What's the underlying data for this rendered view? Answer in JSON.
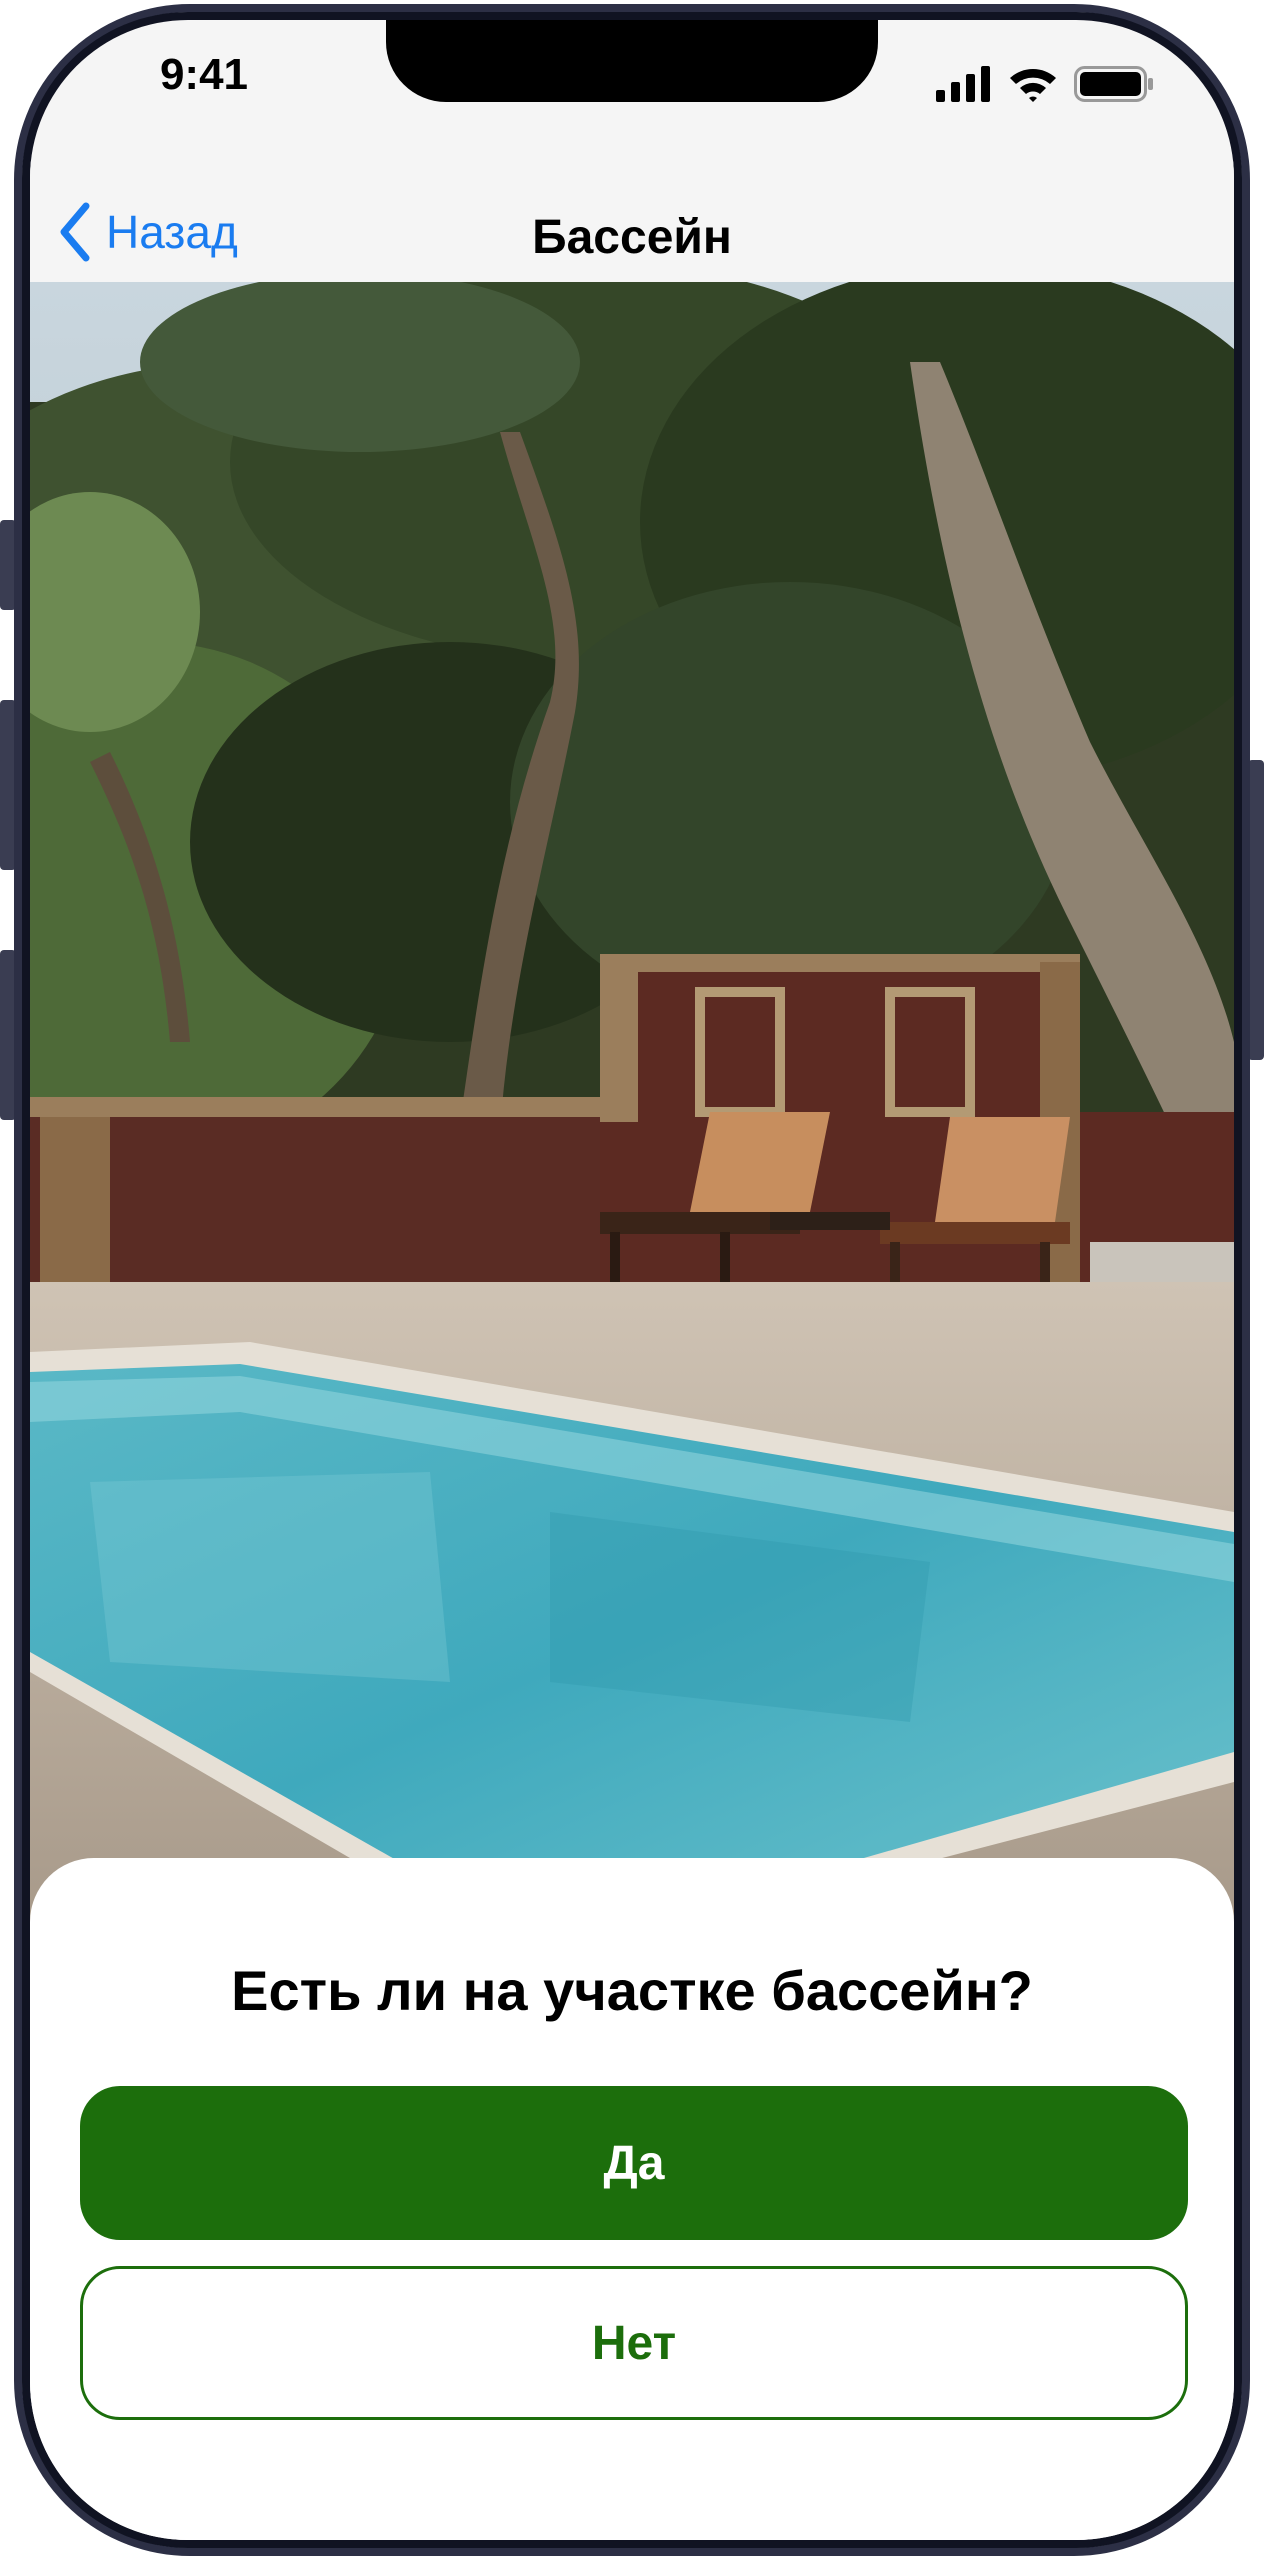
{
  "status_bar": {
    "time": "9:41",
    "icons": [
      "cellular-signal-icon",
      "wifi-icon",
      "battery-icon"
    ]
  },
  "nav": {
    "back_label": "Назад",
    "title": "Бассейн"
  },
  "photo": {
    "subject": "pool-photo"
  },
  "sheet": {
    "question": "Есть ли на участке бассейн?",
    "yes_label": "Да",
    "no_label": "Нет"
  },
  "colors": {
    "accent_green": "#1c6e0c",
    "link_blue": "#1a7cf0",
    "frame": "#2c2f45"
  }
}
